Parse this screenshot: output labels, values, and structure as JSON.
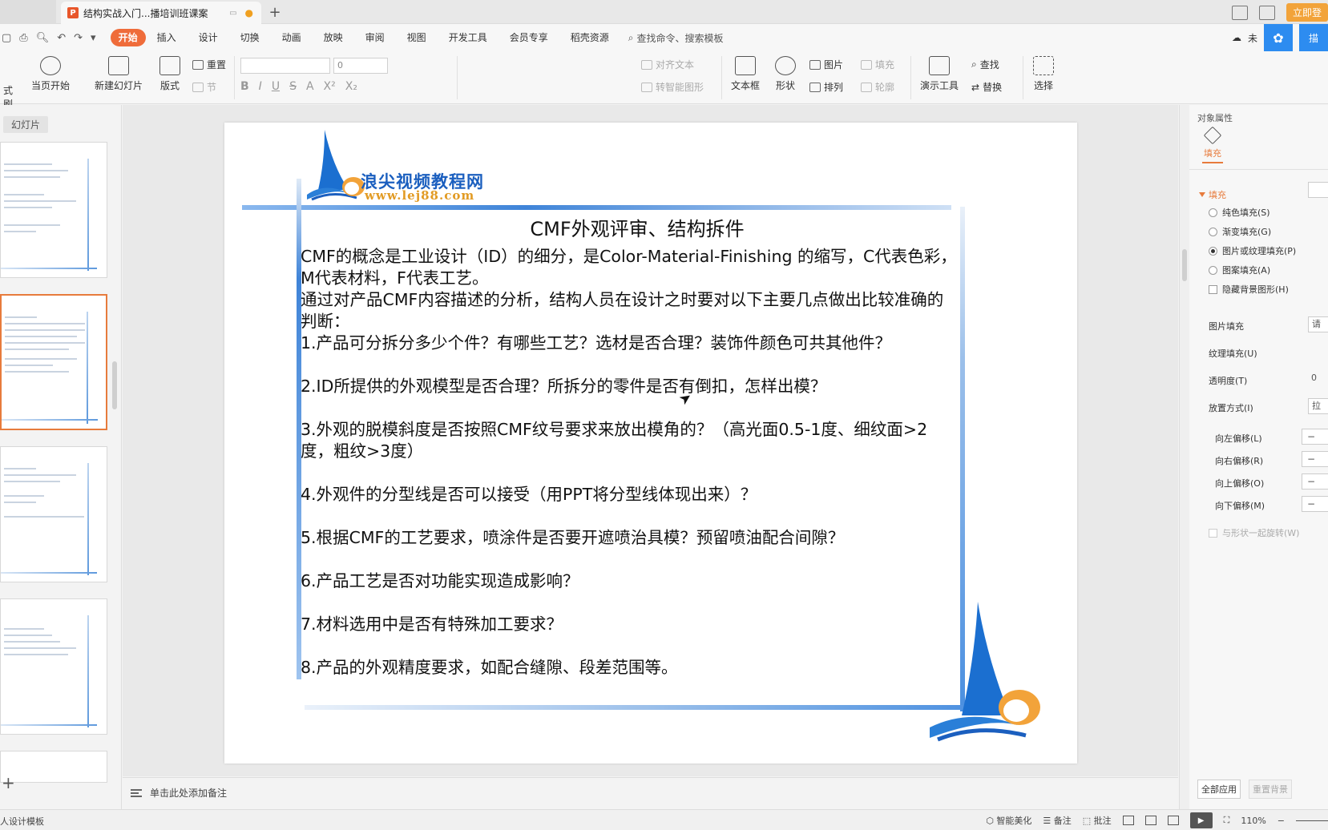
{
  "titlebar": {
    "doc_tab": "结构实战入门...播培训班课案",
    "new_tab": "+",
    "login": "立即登"
  },
  "menubar": {
    "items": [
      "开始",
      "插入",
      "设计",
      "切换",
      "动画",
      "放映",
      "审阅",
      "视图",
      "开发工具",
      "会员专享",
      "稻壳资源"
    ],
    "search": "查找命令、搜索模板",
    "cloud_text": "未",
    "share_text": "描"
  },
  "ribbon": {
    "play_from_current": "当页开始",
    "new_slide": "新建幻灯片",
    "layout": "版式",
    "reset": "重置",
    "section": "节",
    "font_size": "0",
    "align_text": "对齐文本",
    "convert_smartart": "转智能图形",
    "textbox": "文本框",
    "shape": "形状",
    "picture": "图片",
    "fill": "填充",
    "arrange": "排列",
    "outline": "轮廓",
    "presenter_tools": "演示工具",
    "find": "查找",
    "replace": "替换",
    "select": "选择",
    "left_stub": "式刷"
  },
  "left_panel": {
    "slides_label": "幻灯片",
    "add": "+"
  },
  "slide": {
    "logo_cn": "浪尖视频教程网",
    "logo_url": "www.lej88.com",
    "title": "CMF外观评审、结构拆件",
    "paragraphs": [
      "CMF的概念是工业设计（ID）的细分，是Color-Material-Finishing 的缩写，C代表色彩，M代表材料，F代表工艺。",
      "通过对产品CMF内容描述的分析，结构人员在设计之时要对以下主要几点做出比较准确的判断：",
      "1.产品可分拆分多少个件？有哪些工艺？选材是否合理？装饰件颜色可共其他件？",
      "2.ID所提供的外观模型是否合理？所拆分的零件是否有倒扣，怎样出模？",
      "3.外观的脱模斜度是否按照CMF纹号要求来放出模角的？（高光面0.5-1度、细纹面>2度，粗纹>3度）",
      "4.外观件的分型线是否可以接受（用PPT将分型线体现出来）？",
      "5.根据CMF的工艺要求，喷涂件是否要开遮喷治具模？预留喷油配合间隙？",
      "6.产品工艺是否对功能实现造成影响？",
      "7.材料选用中是否有特殊加工要求？",
      "8.产品的外观精度要求，如配合缝隙、段差范围等。"
    ]
  },
  "notes": {
    "placeholder": "单击此处添加备注"
  },
  "right_panel": {
    "title": "对象属性",
    "fill_tab": "填充",
    "fill_section": "填充",
    "options": [
      "纯色填充(S)",
      "渐变填充(G)",
      "图片或纹理填充(P)",
      "图案填充(A)"
    ],
    "hide_bg": "隐藏背景图形(H)",
    "picture_fill": "图片填充",
    "picture_fill_value": "请",
    "texture_fill": "纹理填充(U)",
    "transparency": "透明度(T)",
    "transparency_value": "0",
    "placement": "放置方式(I)",
    "placement_value": "拉",
    "offset_left": "向左偏移(L)",
    "offset_right": "向右偏移(R)",
    "offset_up": "向上偏移(O)",
    "offset_down": "向下偏移(M)",
    "rotate_with_shape": "与形状一起旋转(W)",
    "apply_all": "全部应用",
    "reset_bg": "重置背景"
  },
  "statusbar": {
    "left_text": "人设计模板",
    "beautify": "智能美化",
    "notes": "备注",
    "comments": "批注",
    "zoom": "110%"
  },
  "colors": {
    "accent": "#ef6c3a",
    "brand_blue": "#2d8cf0",
    "logo_blue": "#1b5fbf",
    "logo_orange": "#e29b24"
  }
}
